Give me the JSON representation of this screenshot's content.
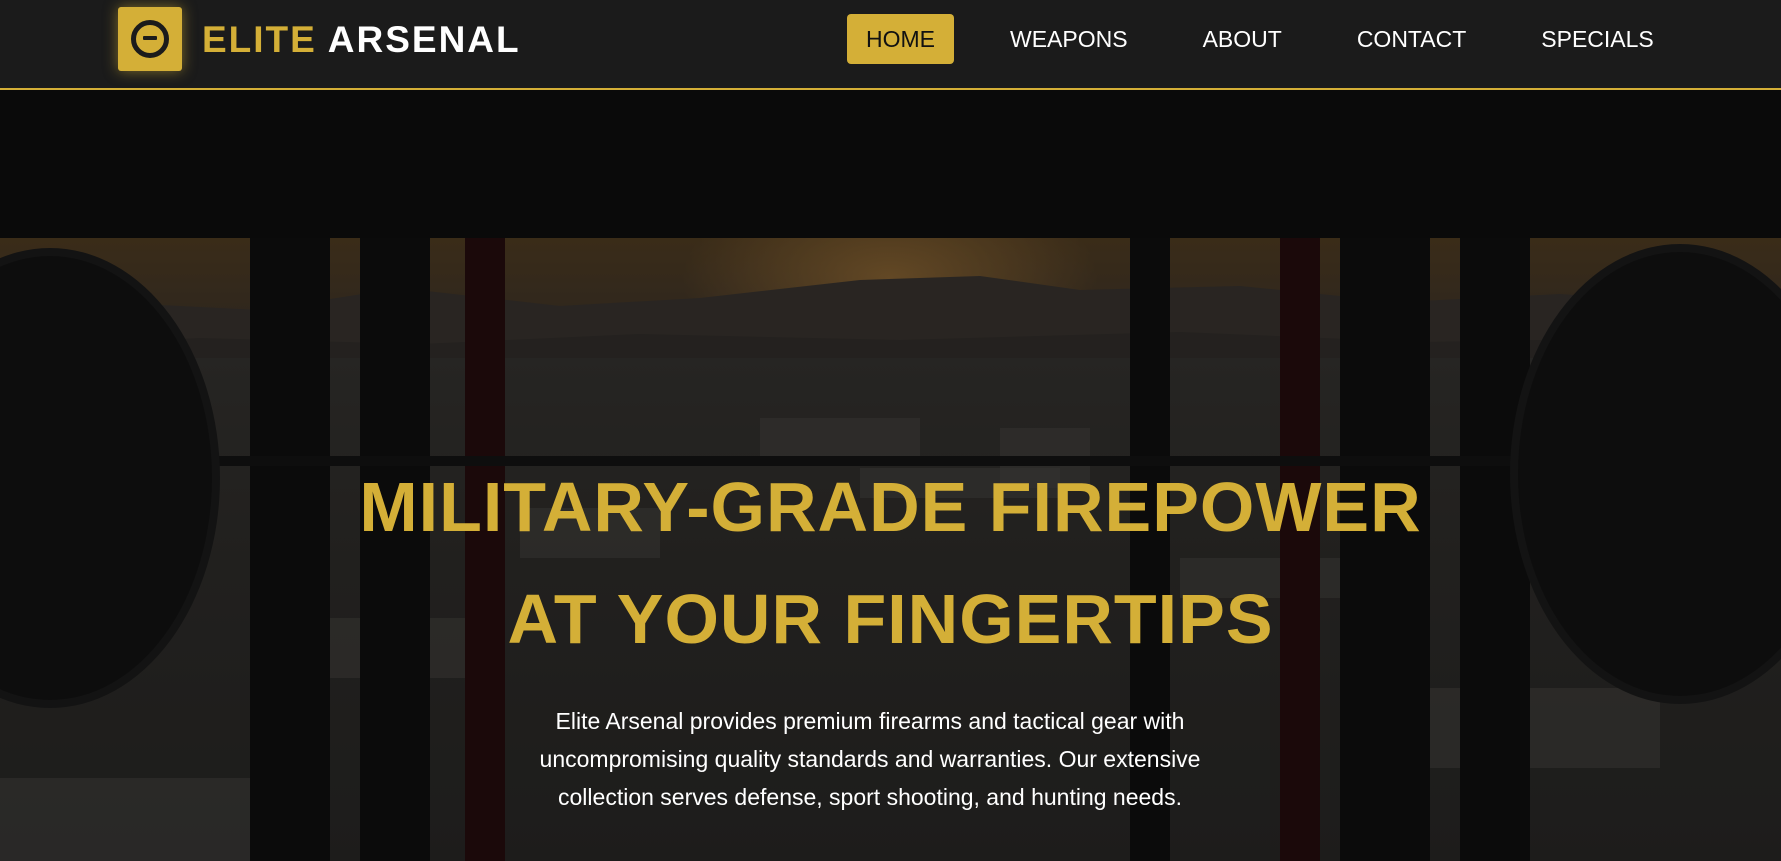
{
  "brand": {
    "name_part1": "ELITE",
    "name_part2": "ARSENAL",
    "logo_icon": "circle-minus-icon",
    "accent_color": "#d4af37"
  },
  "nav": {
    "items": [
      {
        "label": "HOME",
        "active": true
      },
      {
        "label": "WEAPONS",
        "active": false
      },
      {
        "label": "ABOUT",
        "active": false
      },
      {
        "label": "CONTACT",
        "active": false
      },
      {
        "label": "SPECIALS",
        "active": false
      }
    ]
  },
  "hero": {
    "title_line1": "MILITARY-GRADE FIREPOWER",
    "title_line2": "AT YOUR FINGERTIPS",
    "description": "Elite Arsenal provides premium firearms and tactical gear with uncompromising quality standards and warranties. Our extensive collection serves defense, sport shooting, and hunting needs."
  }
}
